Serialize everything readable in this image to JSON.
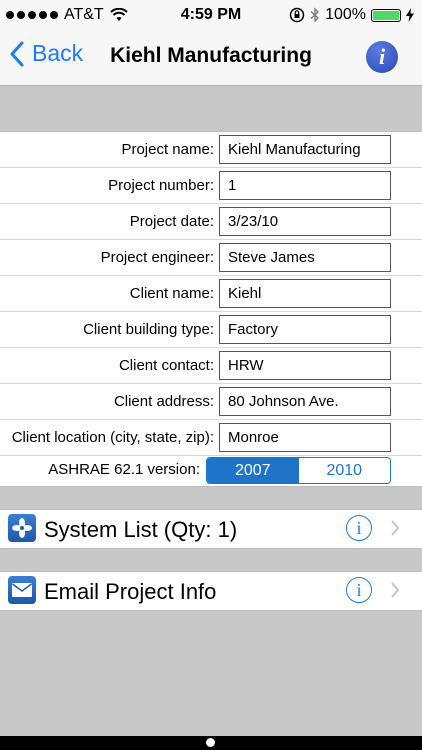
{
  "status_bar": {
    "carrier": "AT&T",
    "time": "4:59 PM",
    "battery": "100%"
  },
  "nav": {
    "back_label": "Back",
    "title": "Kiehl Manufacturing",
    "info_icon": "i"
  },
  "form": {
    "fields": [
      {
        "label": "Project name:",
        "value": "Kiehl Manufacturing"
      },
      {
        "label": "Project number:",
        "value": "1"
      },
      {
        "label": "Project date:",
        "value": "3/23/10"
      },
      {
        "label": "Project engineer:",
        "value": "Steve James"
      },
      {
        "label": "Client name:",
        "value": "Kiehl"
      },
      {
        "label": "Client building type:",
        "value": "Factory"
      },
      {
        "label": "Client contact:",
        "value": "HRW"
      },
      {
        "label": "Client address:",
        "value": "80 Johnson Ave."
      },
      {
        "label": "Client location (city, state, zip):",
        "value": "Monroe"
      }
    ],
    "ashrae": {
      "label": "ASHRAE 62.1 version:",
      "options": [
        "2007",
        "2010"
      ],
      "selected": "2007"
    }
  },
  "sections": [
    {
      "title": "System List (Qty: 1)",
      "icon": "fan-icon"
    },
    {
      "title": "Email Project Info",
      "icon": "envelope-icon"
    }
  ],
  "colors": {
    "accent": "#1a7cf5",
    "segment": "#1e74c8",
    "background": "#cfcfcf"
  }
}
